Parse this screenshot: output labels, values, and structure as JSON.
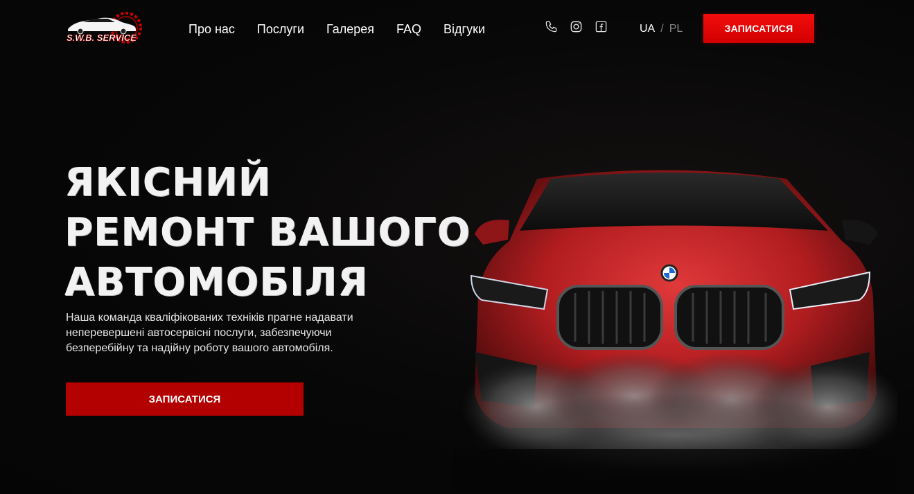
{
  "header": {
    "logo_text": "S.W.B. SERVICE",
    "nav": [
      {
        "label": "Про нас"
      },
      {
        "label": "Послуги"
      },
      {
        "label": "Галерея"
      },
      {
        "label": "FAQ"
      },
      {
        "label": "Відгуки"
      }
    ],
    "social_icons": [
      "phone-icon",
      "instagram-icon",
      "facebook-icon"
    ],
    "languages": {
      "active": "UA",
      "separator": "/",
      "inactive": "PL"
    },
    "cta_label": "ЗАПИСАТИСЯ"
  },
  "hero": {
    "title_lines": [
      "ЯКІСНИЙ",
      "РЕМОНТ ВАШОГО",
      "АВТОМОБІЛЯ"
    ],
    "description": "Наша команда кваліфікованих техніків прагне надавати неперевершені автосервісні послуги, забезпечуючи безперебійну та надійну роботу вашого автомобіля.",
    "cta_label": "ЗАПИСАТИСЯ"
  },
  "colors": {
    "background": "#060606",
    "accent_red": "#e00000",
    "button_dark_red": "#b30000",
    "text": "#ffffff"
  }
}
